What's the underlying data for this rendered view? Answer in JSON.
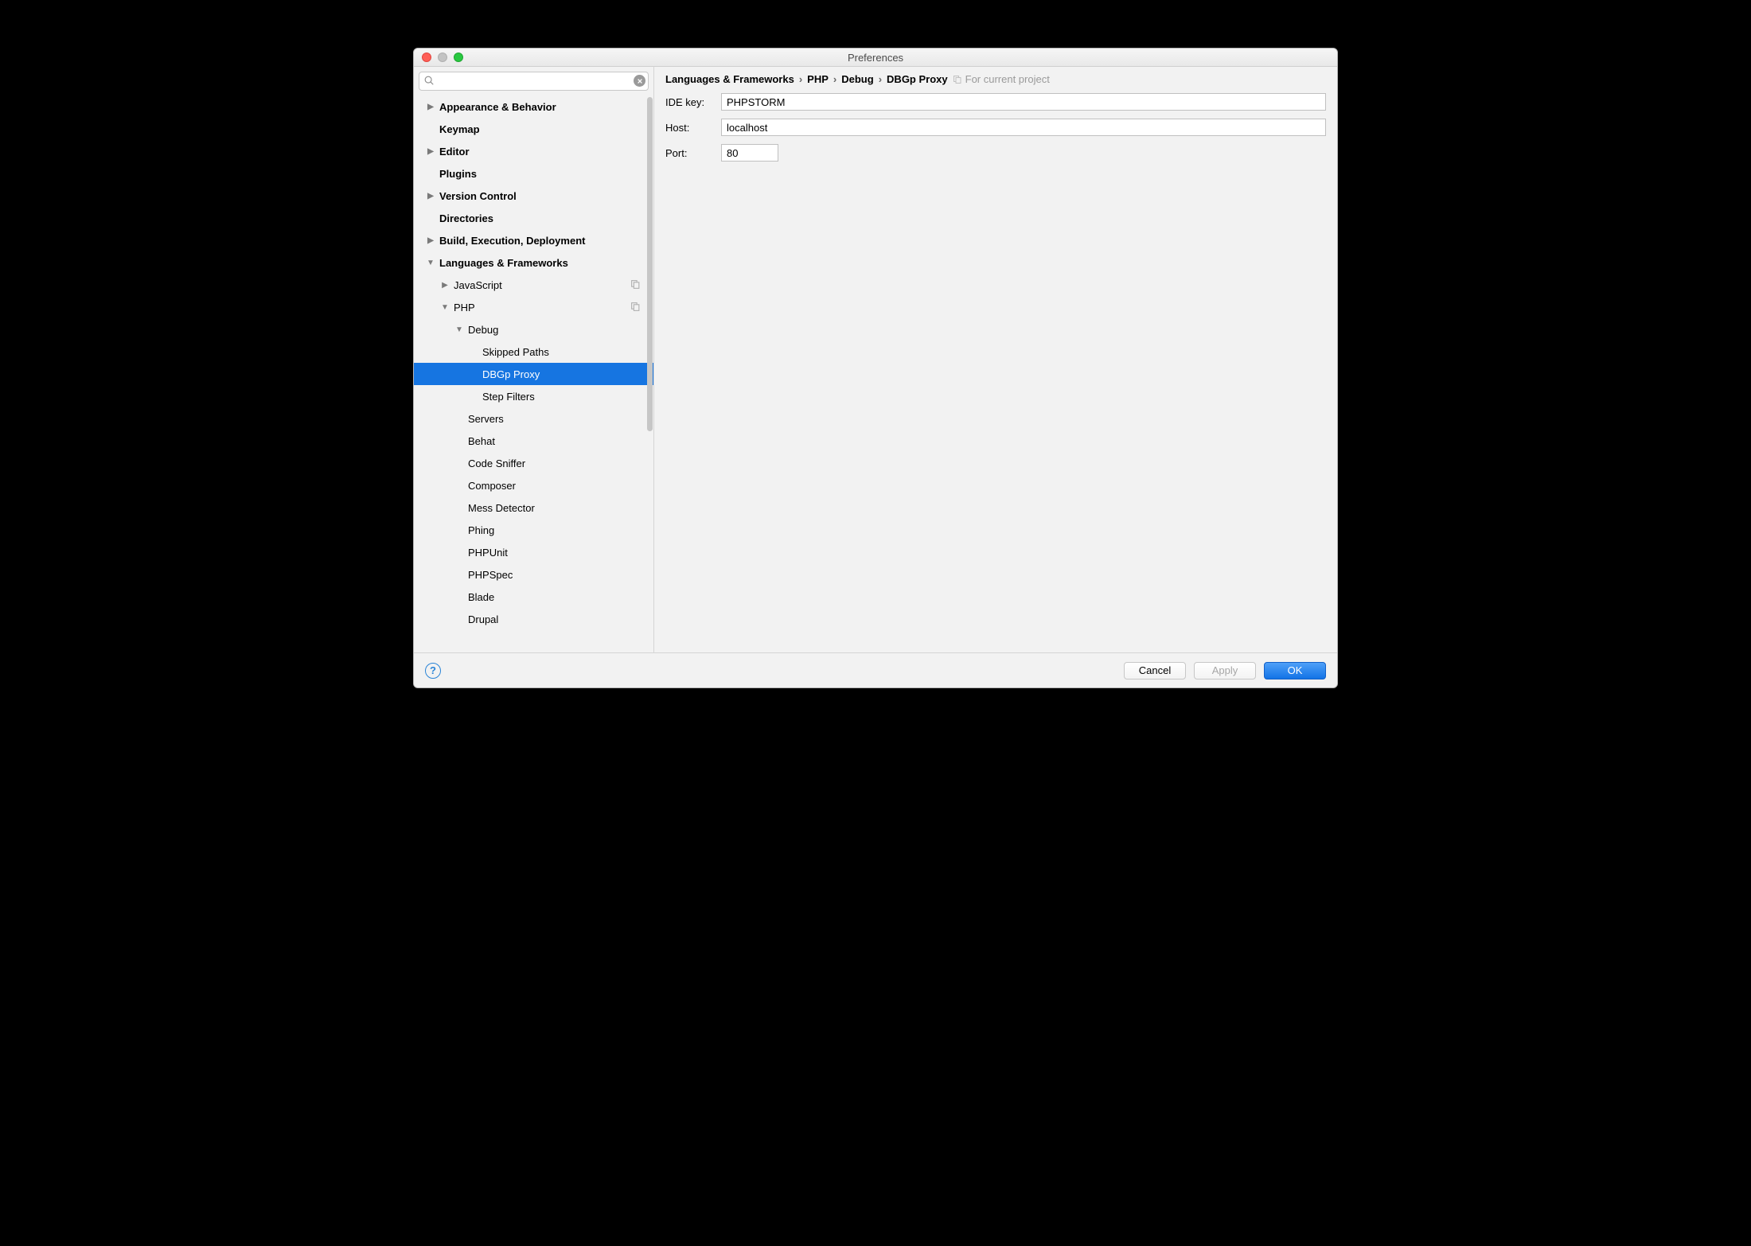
{
  "window": {
    "title": "Preferences"
  },
  "search": {
    "placeholder": ""
  },
  "tree": [
    {
      "label": "Appearance & Behavior",
      "indent": 0,
      "bold": true,
      "arrow": "right"
    },
    {
      "label": "Keymap",
      "indent": 0,
      "bold": true,
      "arrow": "none"
    },
    {
      "label": "Editor",
      "indent": 0,
      "bold": true,
      "arrow": "right"
    },
    {
      "label": "Plugins",
      "indent": 0,
      "bold": true,
      "arrow": "none"
    },
    {
      "label": "Version Control",
      "indent": 0,
      "bold": true,
      "arrow": "right"
    },
    {
      "label": "Directories",
      "indent": 0,
      "bold": true,
      "arrow": "none"
    },
    {
      "label": "Build, Execution, Deployment",
      "indent": 0,
      "bold": true,
      "arrow": "right"
    },
    {
      "label": "Languages & Frameworks",
      "indent": 0,
      "bold": true,
      "arrow": "down"
    },
    {
      "label": "JavaScript",
      "indent": 1,
      "bold": false,
      "arrow": "right",
      "copy": true
    },
    {
      "label": "PHP",
      "indent": 1,
      "bold": false,
      "arrow": "down",
      "copy": true
    },
    {
      "label": "Debug",
      "indent": 2,
      "bold": false,
      "arrow": "down"
    },
    {
      "label": "Skipped Paths",
      "indent": 3,
      "bold": false,
      "arrow": "none"
    },
    {
      "label": "DBGp Proxy",
      "indent": 3,
      "bold": false,
      "arrow": "none",
      "selected": true
    },
    {
      "label": "Step Filters",
      "indent": 3,
      "bold": false,
      "arrow": "none"
    },
    {
      "label": "Servers",
      "indent": 2,
      "bold": false,
      "arrow": "none"
    },
    {
      "label": "Behat",
      "indent": 2,
      "bold": false,
      "arrow": "none"
    },
    {
      "label": "Code Sniffer",
      "indent": 2,
      "bold": false,
      "arrow": "none"
    },
    {
      "label": "Composer",
      "indent": 2,
      "bold": false,
      "arrow": "none"
    },
    {
      "label": "Mess Detector",
      "indent": 2,
      "bold": false,
      "arrow": "none"
    },
    {
      "label": "Phing",
      "indent": 2,
      "bold": false,
      "arrow": "none"
    },
    {
      "label": "PHPUnit",
      "indent": 2,
      "bold": false,
      "arrow": "none"
    },
    {
      "label": "PHPSpec",
      "indent": 2,
      "bold": false,
      "arrow": "none"
    },
    {
      "label": "Blade",
      "indent": 2,
      "bold": false,
      "arrow": "none"
    },
    {
      "label": "Drupal",
      "indent": 2,
      "bold": false,
      "arrow": "none"
    }
  ],
  "breadcrumb": {
    "parts": [
      "Languages & Frameworks",
      "PHP",
      "Debug",
      "DBGp Proxy"
    ],
    "hint": "For current project"
  },
  "form": {
    "ide_key": {
      "label": "IDE key:",
      "value": "PHPSTORM"
    },
    "host": {
      "label": "Host:",
      "value": "localhost"
    },
    "port": {
      "label": "Port:",
      "value": "80"
    }
  },
  "footer": {
    "cancel": "Cancel",
    "apply": "Apply",
    "ok": "OK"
  }
}
